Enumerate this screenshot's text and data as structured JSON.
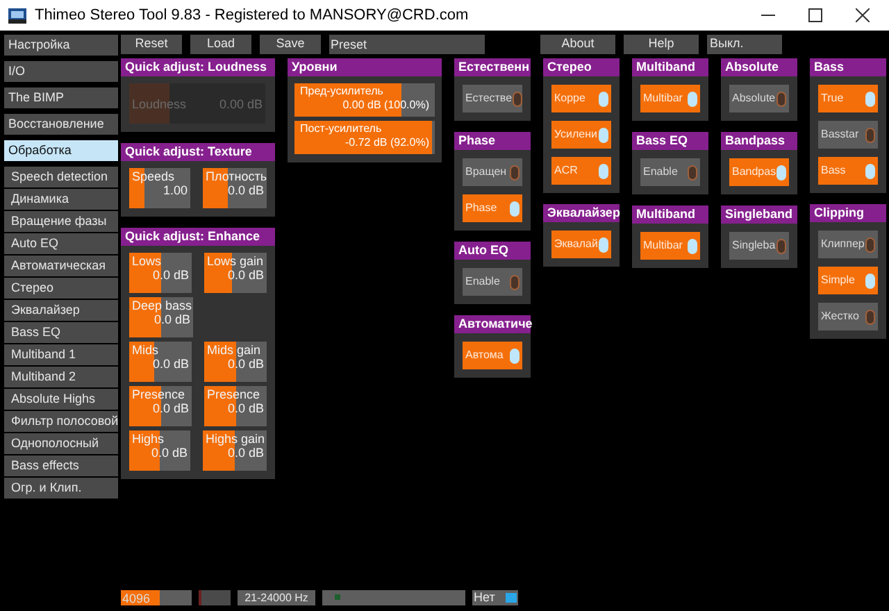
{
  "window": {
    "title": "Thimeo Stereo Tool 9.83 - Registered to MANSORY@CRD.com"
  },
  "sidebar": {
    "items": [
      {
        "label": "Настройка",
        "selected": false
      },
      {
        "label": "I/O",
        "selected": false
      },
      {
        "label": "The BIMP",
        "selected": false
      },
      {
        "label": "Восстановление",
        "selected": false
      },
      {
        "label": "Обработка",
        "selected": true,
        "children": [
          {
            "label": "Speech detection",
            "selected": false
          },
          {
            "label": "Динамика",
            "selected": false
          },
          {
            "label": "Вращение фазы",
            "selected": false
          },
          {
            "label": "Auto EQ",
            "selected": false
          },
          {
            "label": "Автоматическая",
            "selected": false
          },
          {
            "label": "Стерео",
            "selected": false
          },
          {
            "label": "Эквалайзер",
            "selected": false
          },
          {
            "label": "Bass EQ",
            "selected": false
          },
          {
            "label": "Multiband 1",
            "selected": false
          },
          {
            "label": "Multiband 2",
            "selected": false
          },
          {
            "label": "Absolute Highs",
            "selected": false
          },
          {
            "label": "Фильтр полосовой",
            "selected": false
          },
          {
            "label": "Однополосный",
            "selected": false
          },
          {
            "label": "Bass effects",
            "selected": false
          },
          {
            "label": "Огр. и Клип.",
            "selected": false
          }
        ]
      }
    ]
  },
  "toolbar": {
    "left": [
      "Reset",
      "Load",
      "Save"
    ],
    "preset": "Preset",
    "right": [
      "About",
      "Help",
      "Выкл."
    ]
  },
  "columns": [
    {
      "panels": [
        {
          "kind": "sliders",
          "title": "Quick adjust: Loudness",
          "rows": [
            [
              {
                "label": "Loudness",
                "value": "0.00 dB",
                "level": 0.3,
                "disabled": true
              }
            ]
          ]
        },
        {
          "kind": "sliders",
          "title": "Quick adjust: Texture",
          "rows": [
            [
              {
                "label": "Speeds",
                "value": "1.00",
                "level": 0.25,
                "disabled": false
              },
              {
                "label": "Плотность",
                "value": "0.0 dB",
                "level": 0.4,
                "disabled": false
              }
            ]
          ]
        },
        {
          "kind": "sliders",
          "title": "Quick adjust: Enhance",
          "rows": [
            [
              {
                "label": "Lows",
                "value": "0.0 dB",
                "level": 0.5,
                "disabled": false
              },
              {
                "label": "Lows gain",
                "value": "0.0 dB",
                "level": 0.45,
                "disabled": false
              }
            ],
            [
              {
                "label": "Deep bass",
                "value": "0.0 dB",
                "level": 0.5,
                "disabled": false
              }
            ],
            [
              {
                "label": "Mids",
                "value": "0.0 dB",
                "level": 0.4,
                "disabled": false
              },
              {
                "label": "Mids gain",
                "value": "0.0 dB",
                "level": 0.5,
                "disabled": false
              }
            ],
            [
              {
                "label": "Presence",
                "value": "0.0 dB",
                "level": 0.5,
                "disabled": false
              },
              {
                "label": "Presence",
                "value": "0.0 dB",
                "level": 0.5,
                "disabled": false
              }
            ],
            [
              {
                "label": "Highs",
                "value": "0.0 dB",
                "level": 0.5,
                "disabled": false
              },
              {
                "label": "Highs gain",
                "value": "0.0 dB",
                "level": 0.5,
                "disabled": false
              }
            ]
          ]
        }
      ]
    },
    {
      "panels": [
        {
          "kind": "levels",
          "title": "Уровни",
          "items": [
            {
              "label": "Пред-усилитель",
              "value": "0.00 dB (100.0%)",
              "level": 0.76
            },
            {
              "label": "Пост-усилитель",
              "value": "-0.72 dB (92.0%)",
              "level": 0.98
            }
          ]
        }
      ]
    },
    {
      "panels": [
        {
          "kind": "toggles",
          "title": "Естественн",
          "items": [
            {
              "label": "Естестве",
              "on": false
            }
          ]
        },
        {
          "kind": "toggles",
          "title": "Phase",
          "items": [
            {
              "label": "Вращен",
              "on": false
            },
            {
              "label": "Phase",
              "on": true
            }
          ]
        },
        {
          "kind": "toggles",
          "title": "Auto EQ",
          "items": [
            {
              "label": "Enable",
              "on": false
            }
          ]
        },
        {
          "kind": "toggles",
          "title": "Автоматиче",
          "items": [
            {
              "label": "Автома",
              "on": true
            }
          ]
        }
      ]
    },
    {
      "panels": [
        {
          "kind": "toggles",
          "title": "Стерео",
          "items": [
            {
              "label": "Корре",
              "on": true
            },
            {
              "label": "Усилени",
              "on": true
            },
            {
              "label": "ACR",
              "on": true
            }
          ]
        },
        {
          "kind": "toggles",
          "title": "Эквалайзер",
          "items": [
            {
              "label": "Эквалай",
              "on": true
            }
          ]
        }
      ]
    },
    {
      "panels": [
        {
          "kind": "toggles",
          "title": "Multiband",
          "items": [
            {
              "label": "Multibar",
              "on": true
            }
          ]
        },
        {
          "kind": "toggles",
          "title": "Bass EQ",
          "items": [
            {
              "label": "Enable",
              "on": false
            }
          ]
        },
        {
          "kind": "toggles",
          "title": "Multiband",
          "items": [
            {
              "label": "Multibar",
              "on": true
            }
          ]
        }
      ]
    },
    {
      "panels": [
        {
          "kind": "toggles",
          "title": "Absolute",
          "items": [
            {
              "label": "Absolute",
              "on": false
            }
          ]
        },
        {
          "kind": "toggles",
          "title": "Bandpass",
          "items": [
            {
              "label": "Bandpas",
              "on": true
            }
          ]
        },
        {
          "kind": "toggles",
          "title": "Singleband",
          "items": [
            {
              "label": "Singleba",
              "on": false
            }
          ]
        }
      ]
    },
    {
      "panels": [
        {
          "kind": "toggles",
          "title": "Bass",
          "items": [
            {
              "label": "True",
              "on": true
            },
            {
              "label": "Basstar",
              "on": false
            },
            {
              "label": "Bass",
              "on": true
            }
          ]
        },
        {
          "kind": "toggles",
          "title": "Clipping",
          "items": [
            {
              "label": "Клиппер",
              "on": false
            },
            {
              "label": "Simple",
              "on": true
            },
            {
              "label": "Жестко",
              "on": false
            }
          ]
        }
      ]
    }
  ],
  "status_bar": {
    "buffer": {
      "value": "4096",
      "level": 0.55
    },
    "meter": {
      "level": 0.08
    },
    "range": "21-24000 Hz",
    "mode": {
      "label": "Нет",
      "on": true
    }
  }
}
